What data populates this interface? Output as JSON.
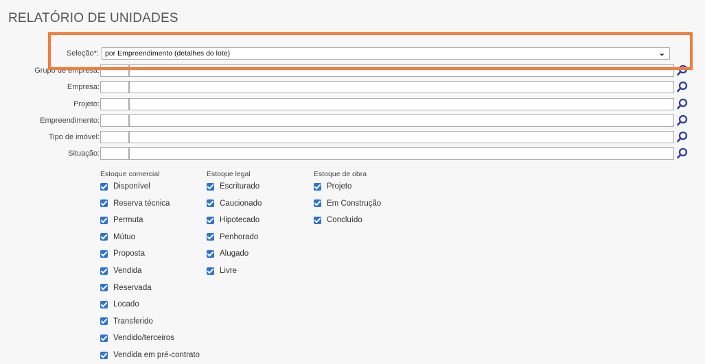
{
  "page": {
    "title": "RELATÓRIO DE UNIDADES"
  },
  "form": {
    "selecao_label": "Seleção*:",
    "selecao_value": "por Empreendimento (detalhes do lote)",
    "fields": [
      {
        "label": "Grupo de empresa:"
      },
      {
        "label": "Empresa:"
      },
      {
        "label": "Projeto:"
      },
      {
        "label": "Empreendimento:"
      },
      {
        "label": "Tipo de imóvel:"
      },
      {
        "label": "Situação:"
      }
    ]
  },
  "columns": [
    {
      "header": "Estoque comercial",
      "items": [
        "Disponível",
        "Reserva técnica",
        "Permuta",
        "Mútuo",
        "Proposta",
        "Vendida",
        "Reservada",
        "Locado",
        "Transferido",
        "Vendido/terceiros",
        "Vendida em pré-contrato"
      ]
    },
    {
      "header": "Estoque legal",
      "items": [
        "Escriturado",
        "Caucionado",
        "Hipotecado",
        "Penhorado",
        "Alugado",
        "Livre"
      ]
    },
    {
      "header": "Estoque de obra",
      "items": [
        "Projeto",
        "Em Construção",
        "Concluído"
      ]
    }
  ],
  "colors": {
    "highlight": "#f47c3c",
    "checkbox": "#2b73d6",
    "search_icon": "#2a3aa8"
  }
}
